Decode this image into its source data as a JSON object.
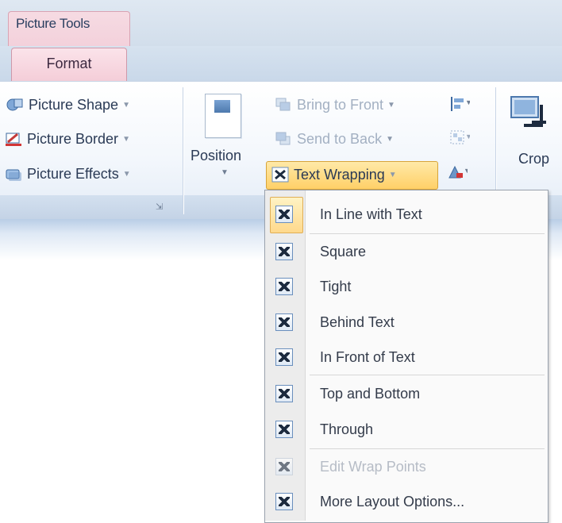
{
  "contextual_tab": {
    "group_title": "Picture Tools",
    "tab_label": "Format"
  },
  "picture_styles": {
    "items": [
      {
        "label": "Picture Shape",
        "icon": "picture-shape-icon"
      },
      {
        "label": "Picture Border",
        "icon": "picture-border-icon"
      },
      {
        "label": "Picture Effects",
        "icon": "picture-effects-icon"
      }
    ]
  },
  "arrange": {
    "position_label": "Position",
    "bring_to_front": "Bring to Front",
    "send_to_back": "Send to Back",
    "text_wrapping": "Text Wrapping"
  },
  "size": {
    "crop_label": "Crop"
  },
  "menu": {
    "items": [
      {
        "label": "In Line with Text"
      },
      {
        "label": "Square"
      },
      {
        "label": "Tight"
      },
      {
        "label": "Behind Text"
      },
      {
        "label": "In Front of Text"
      },
      {
        "label": "Top and Bottom"
      },
      {
        "label": "Through"
      },
      {
        "label": "Edit Wrap Points"
      },
      {
        "label": "More Layout Options..."
      }
    ]
  },
  "colors": {
    "accent_highlight": "#ffd067",
    "context_pink": "#f4cdd8",
    "ribbon_blue": "#c9d8e9"
  }
}
